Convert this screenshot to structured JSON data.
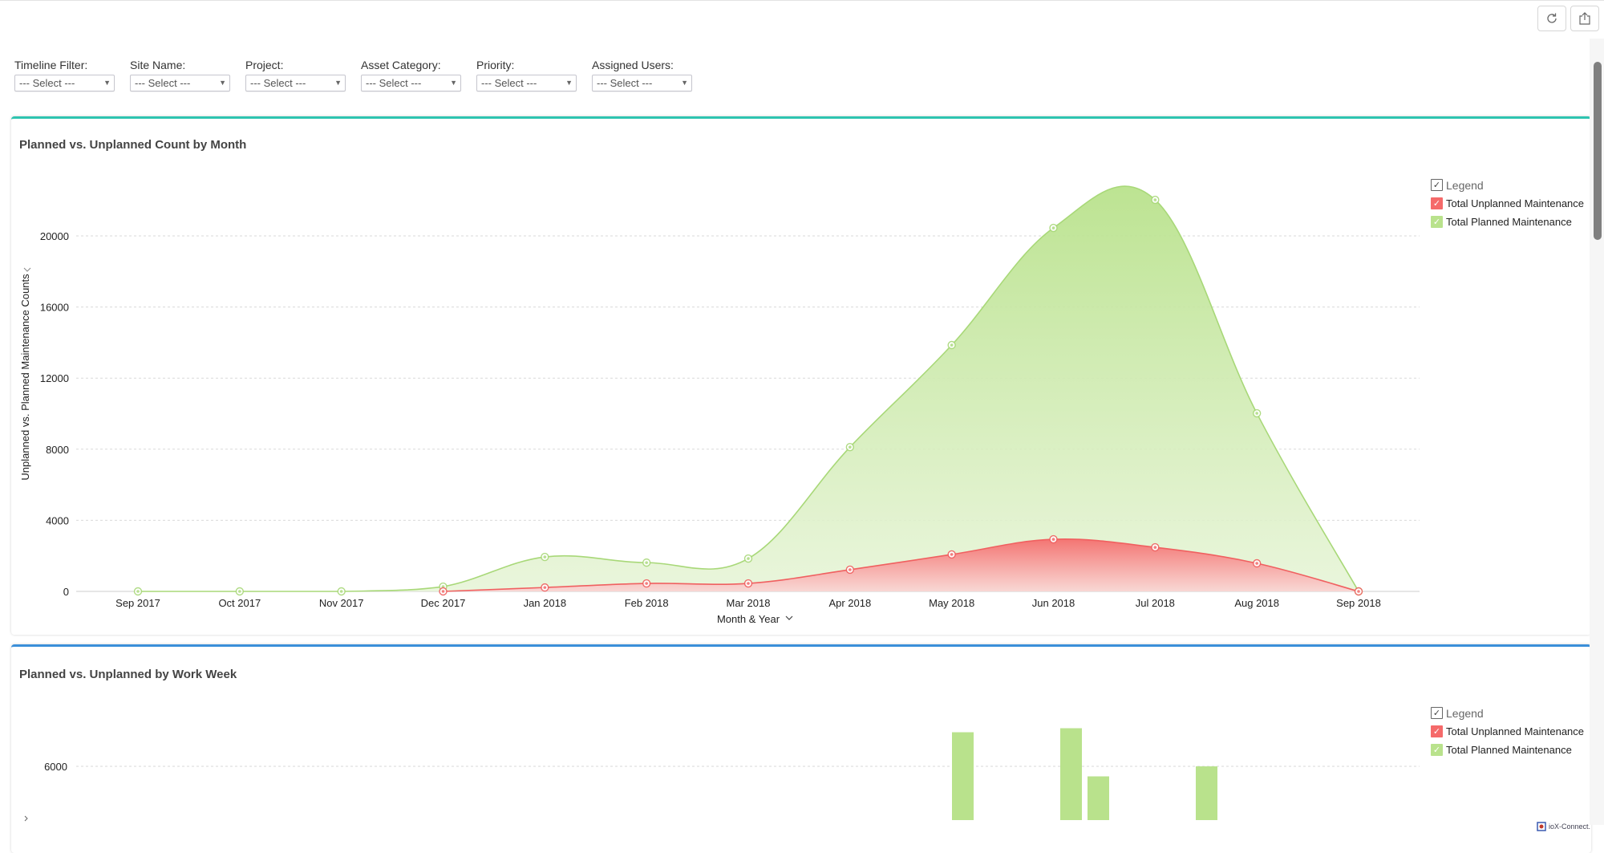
{
  "toolbar": {
    "refresh_icon": "refresh-icon",
    "export_icon": "share-export-icon"
  },
  "filters": [
    {
      "label": "Timeline Filter:",
      "value": "--- Select ---"
    },
    {
      "label": "Site Name:",
      "value": "--- Select ---"
    },
    {
      "label": "Project:",
      "value": "--- Select ---"
    },
    {
      "label": "Asset Category:",
      "value": "--- Select ---"
    },
    {
      "label": "Priority:",
      "value": "--- Select ---"
    },
    {
      "label": "Assigned Users:",
      "value": "--- Select ---"
    }
  ],
  "colors": {
    "planned": "#b9e28c",
    "unplanned": "#f56a6a",
    "card1_accent": "#2ec4b0",
    "card2_accent": "#3b8fd9"
  },
  "legend": {
    "title": "Legend",
    "items": [
      "Total Unplanned Maintenance",
      "Total Planned Maintenance"
    ]
  },
  "chart_data": [
    {
      "type": "area",
      "title": "Planned vs. Unplanned Count by Month",
      "xlabel": "Month & Year",
      "ylabel": "Unplanned vs. Planned Maintenance Counts",
      "categories": [
        "Sep 2017",
        "Oct 2017",
        "Nov 2017",
        "Dec 2017",
        "Jan 2018",
        "Feb 2018",
        "Mar 2018",
        "Apr 2018",
        "May 2018",
        "Jun 2018",
        "Jul 2018",
        "Aug 2018",
        "Sep 2018"
      ],
      "yticks": [
        "0",
        "4000",
        "8000",
        "12000",
        "16000",
        "20000"
      ],
      "ylim": [
        0,
        24000
      ],
      "grid": true,
      "legend_position": "top-right",
      "series": [
        {
          "name": "Total Planned Maintenance",
          "values": [
            0,
            0,
            0,
            270,
            1940,
            1620,
            1850,
            8120,
            13860,
            20450,
            22030,
            10020,
            0
          ]
        },
        {
          "name": "Total Unplanned Maintenance",
          "values": [
            null,
            null,
            null,
            0,
            220,
            450,
            450,
            1220,
            2080,
            2930,
            2480,
            1580,
            0
          ]
        }
      ]
    },
    {
      "type": "bar",
      "title": "Planned vs. Unplanned by Work Week",
      "yticks": [
        "6000"
      ],
      "grid": true,
      "legend_position": "top-right",
      "series": [
        {
          "name": "Total Planned Maintenance",
          "values": [
            7700,
            7900,
            5500,
            6000
          ]
        }
      ]
    }
  ],
  "brand": "ioX-Connect."
}
